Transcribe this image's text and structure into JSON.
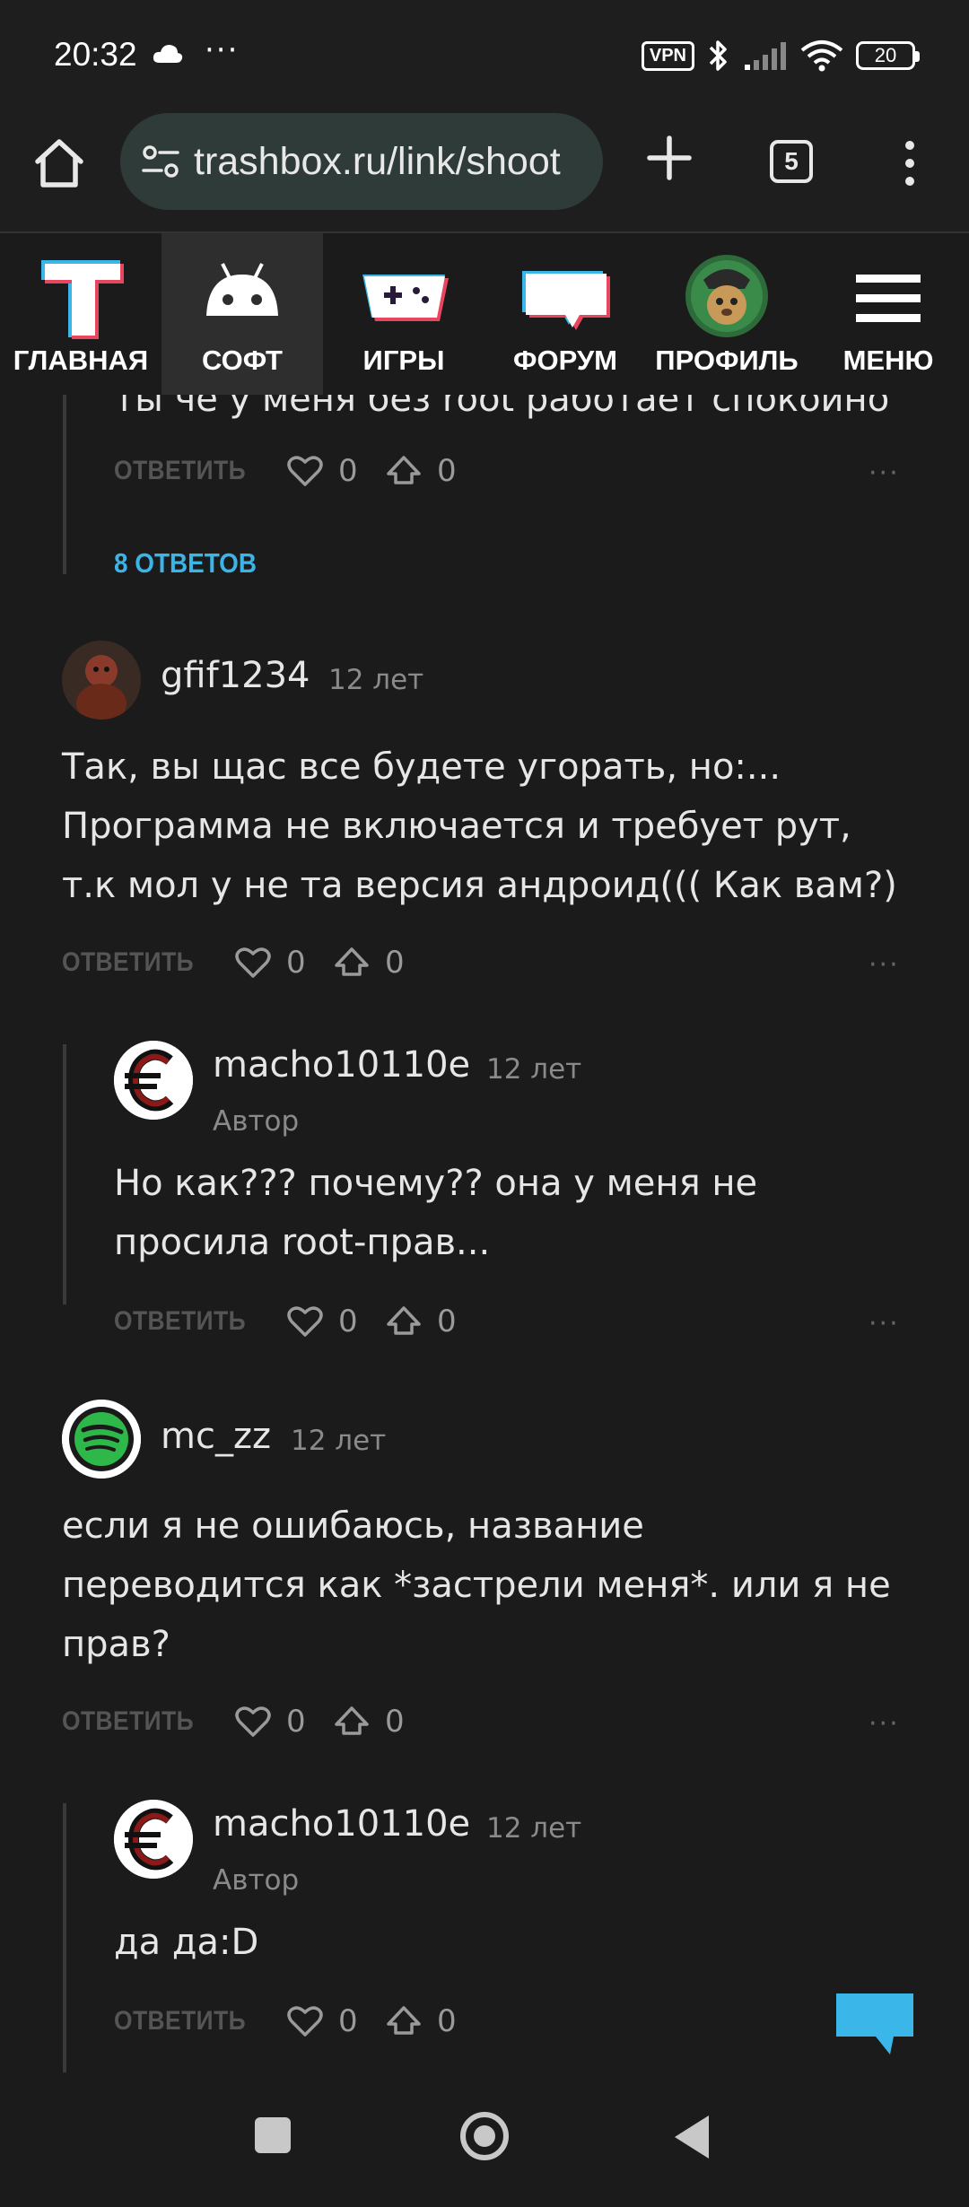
{
  "status_bar": {
    "time": "20:32",
    "dots": "···",
    "vpn": "VPN",
    "battery": "20",
    "icons": [
      "cloud-icon",
      "bluetooth-icon",
      "signal-icon",
      "wifi-icon",
      "battery-icon"
    ]
  },
  "browser": {
    "url": "trashbox.ru/link/shoot",
    "tab_count": "5"
  },
  "site_nav": [
    {
      "label": "ГЛАВНАЯ",
      "icon": "trashbox-logo-icon",
      "active": false
    },
    {
      "label": "СОФТ",
      "icon": "android-icon",
      "active": true
    },
    {
      "label": "ИГРЫ",
      "icon": "gamepad-icon",
      "active": false
    },
    {
      "label": "ФОРУМ",
      "icon": "forum-icon",
      "active": false
    },
    {
      "label": "ПРОФИЛЬ",
      "icon": "profile-avatar-icon",
      "active": false
    },
    {
      "label": "МЕНЮ",
      "icon": "hamburger-menu-icon",
      "active": false
    }
  ],
  "comments": {
    "partial": {
      "text": "ты че у меня без root работает спокойно",
      "reply_label": "ОТВЕТИТЬ",
      "likes": "0",
      "dislikes": "0",
      "answers_label": "8 ОТВЕТОВ"
    },
    "c1": {
      "username": "gfif1234",
      "time": "12 лет",
      "text_lines": [
        "Так, вы щас все будете угорать, но:...",
        "Программа не включается и требует рут,",
        "т.к мол у не та версия андроид((( Как вам?)"
      ],
      "reply_label": "ОТВЕТИТЬ",
      "likes": "0",
      "dislikes": "0"
    },
    "r1": {
      "username": "macho10110e",
      "time": "12 лет",
      "role": "Автор",
      "text_lines": [
        "Но как??? почему?? она у меня не",
        "просила root-прав..."
      ],
      "reply_label": "ОТВЕТИТЬ",
      "likes": "0",
      "dislikes": "0"
    },
    "c2": {
      "username": "mc_zz",
      "time": "12 лет",
      "text_lines": [
        "если я не ошибаюсь, название",
        "переводится как *застрели меня*. или я не",
        "прав?"
      ],
      "reply_label": "ОТВЕТИТЬ",
      "likes": "0",
      "dislikes": "0"
    },
    "r2": {
      "username": "macho10110e",
      "time": "12 лет",
      "role": "Автор",
      "text_lines": [
        "да да:D"
      ],
      "reply_label": "ОТВЕТИТЬ",
      "likes": "0",
      "dislikes": "0"
    }
  },
  "more_label": "···",
  "colors": {
    "background": "#1b1b1b",
    "accent_blue": "#3cb4e6",
    "url_bar": "#2f3b38"
  }
}
